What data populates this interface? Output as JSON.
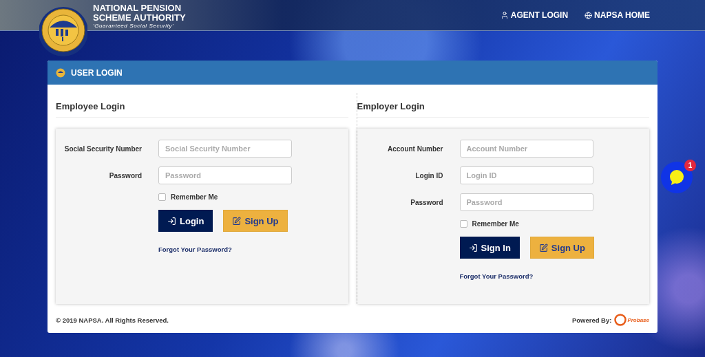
{
  "header": {
    "org_name_line1": "NATIONAL PENSION",
    "org_name_line2": "SCHEME AUTHORITY",
    "tagline": "'Guaranteed Social Security'",
    "nav": [
      {
        "label": "AGENT LOGIN",
        "kind": "agent"
      },
      {
        "label": "NAPSA HOME",
        "kind": "home"
      }
    ]
  },
  "card": {
    "title": "USER LOGIN",
    "panels": [
      {
        "title": "Employee Login",
        "fields": [
          {
            "label": "Social Security Number",
            "placeholder": "Social Security Number"
          },
          {
            "label": "Password",
            "placeholder": "Password"
          }
        ],
        "remember": {
          "label": "Remember Me",
          "checked": false
        },
        "buttons": [
          {
            "label": "Login",
            "kind": "primary"
          },
          {
            "label": "Sign Up",
            "kind": "signup"
          }
        ],
        "forgot": "Forgot Your Password?"
      },
      {
        "title": "Employer Login",
        "fields": [
          {
            "label": "Account Number",
            "placeholder": "Account Number"
          },
          {
            "label": "Login ID",
            "placeholder": "Login ID"
          },
          {
            "label": "Password",
            "placeholder": "Password"
          }
        ],
        "remember": {
          "label": "Remember Me",
          "checked": false
        },
        "buttons": [
          {
            "label": "Sign In",
            "kind": "primary"
          },
          {
            "label": "Sign Up",
            "kind": "signup"
          }
        ],
        "forgot": "Forgot Your Password?"
      }
    ],
    "copyright": "© 2019 NAPSA. All Rights Reserved.",
    "powered_by": "Powered By:",
    "powered_logo": "Probase"
  },
  "chat": {
    "badge": "1"
  }
}
